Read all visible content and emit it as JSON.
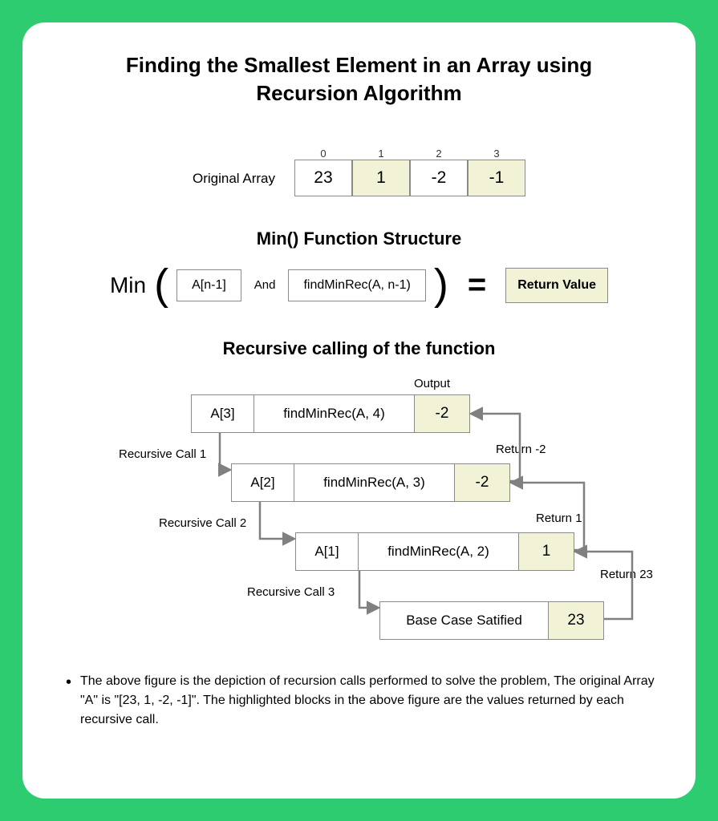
{
  "title_line1": "Finding the Smallest Element in an Array using",
  "title_line2": "Recursion Algorithm",
  "orig_label": "Original Array",
  "arr_idx": [
    "0",
    "1",
    "2",
    "3"
  ],
  "arr_vals": [
    "23",
    "1",
    "-2",
    "-1"
  ],
  "sub_min": "Min() Function Structure",
  "min_word": "Min",
  "lparen": "(",
  "rparen": ")",
  "box_a": "A[n-1]",
  "and_word": "And",
  "box_f": "findMinRec(A, n-1)",
  "eq": "=",
  "retval": "Return Value",
  "sub_rec": "Recursive calling of the function",
  "output_label": "Output",
  "rows": [
    {
      "a": "A[3]",
      "f": "findMinRec(A, 4)",
      "r": "-2",
      "call": "Recursive Call 1",
      "ret": "Return -2"
    },
    {
      "a": "A[2]",
      "f": "findMinRec(A, 3)",
      "r": "-2",
      "call": "Recursive Call 2",
      "ret": "Return 1"
    },
    {
      "a": "A[1]",
      "f": "findMinRec(A, 2)",
      "r": "1",
      "call": "Recursive Call 3",
      "ret": "Return 23"
    }
  ],
  "base": {
    "f": "Base Case Satified",
    "r": "23"
  },
  "footnote": "The above figure is the depiction of recursion calls performed to solve the problem, The original Array \"A\" is \"[23, 1, -2, -1]\". The highlighted blocks in the above figure are the values returned by each recursive call."
}
